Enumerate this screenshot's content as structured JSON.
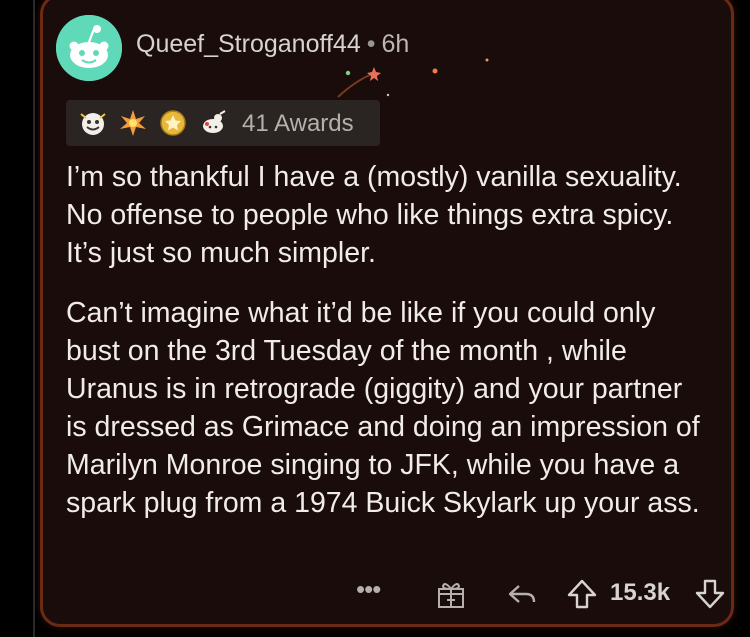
{
  "comment": {
    "username": "Queef_Stroganoff44",
    "separator": "•",
    "age": "6h",
    "avatar_icon": "snoo-avatar-icon",
    "awards": {
      "count_label": "41 Awards",
      "icons": [
        "wholesome-award-icon",
        "burst-award-icon",
        "gold-award-icon",
        "bless-award-icon"
      ]
    },
    "paragraphs": [
      "I’m so thankful I have a (mostly) vanilla sexuality. No offense to people who like things extra spicy. It’s just so much simpler.",
      "Can’t imagine what it’d be like if you could only bust on the 3rd Tuesday of the month , while Uranus is in retrograde (giggity) and your partner is dressed as Grimace and doing an impression of Marilyn Monroe singing to JFK, while you have a spark plug from a 1974 Buick Skylark up your ass."
    ],
    "actions": {
      "more_label": "•••",
      "award_button_icon": "gift-icon",
      "reply_button_icon": "reply-icon",
      "upvote_icon": "upvote-arrow-icon",
      "vote_count": "15.3k",
      "downvote_icon": "downvote-arrow-icon"
    }
  },
  "colors": {
    "card_background": "#1a0c0a",
    "card_border": "#6a2a14",
    "avatar": "#5fd9b7",
    "text": "#f0ece8",
    "muted": "#b6b0aa"
  }
}
